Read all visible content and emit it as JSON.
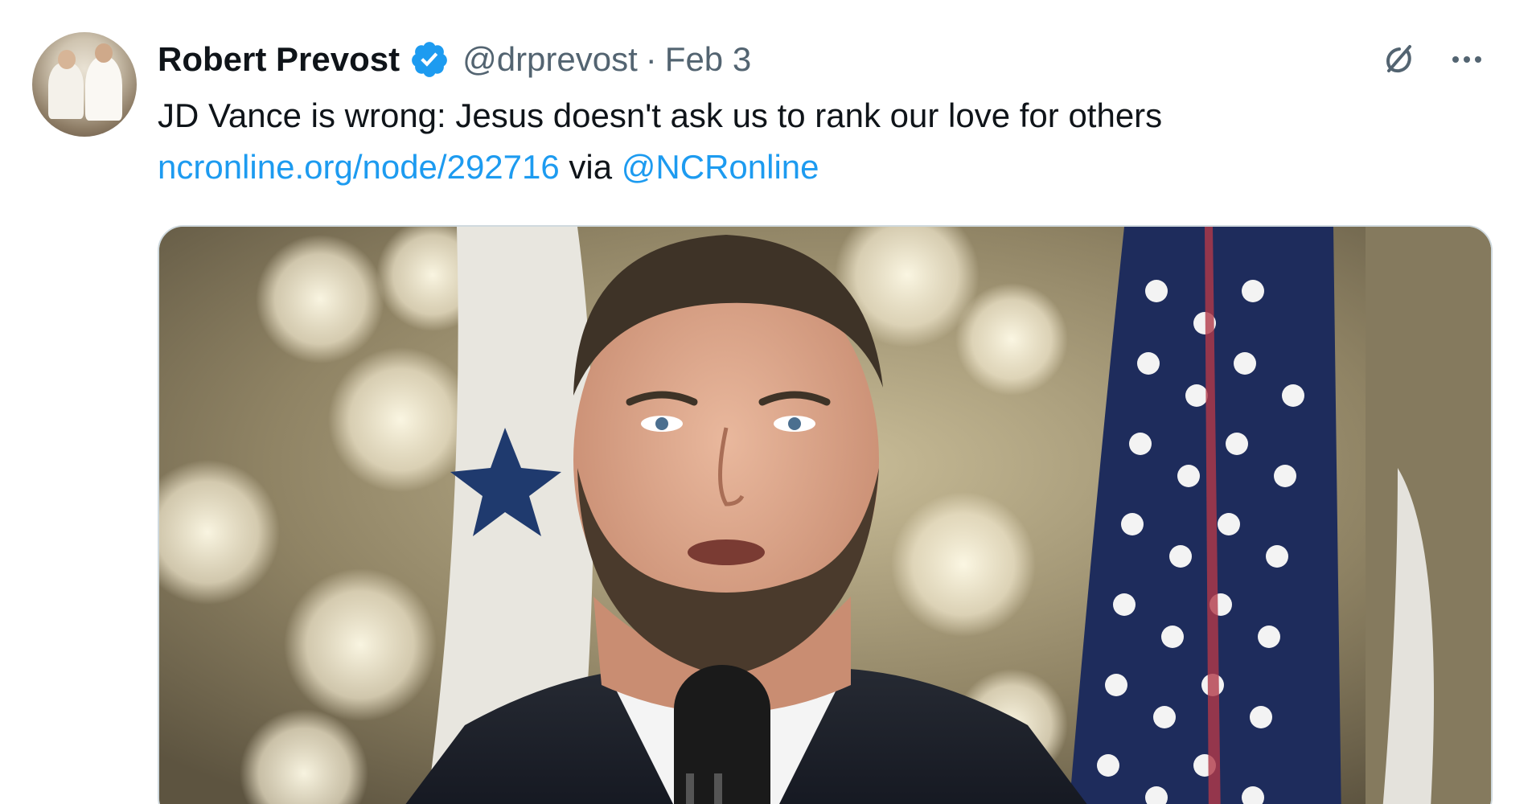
{
  "tweet": {
    "author_name": "Robert Prevost",
    "verified_icon": "verified-badge-icon",
    "handle": "@drprevost",
    "separator": "·",
    "date": "Feb 3",
    "text_line1": "JD Vance is wrong: Jesus doesn't ask us to rank our love for others",
    "link_text": "ncronline.org/node/292716",
    "via_text": "via",
    "mention_text": "@NCRonline",
    "actions": {
      "grok_icon": "grok-icon",
      "more_icon": "more-options-icon"
    },
    "media": {
      "type": "photo",
      "description_icon": "photo-of-speaker-at-microphone"
    }
  },
  "colors": {
    "link": "#1d9bf0",
    "secondary_text": "#536471",
    "primary_text": "#0f1419",
    "verified": "#1d9bf0",
    "border": "#cfd9de"
  }
}
